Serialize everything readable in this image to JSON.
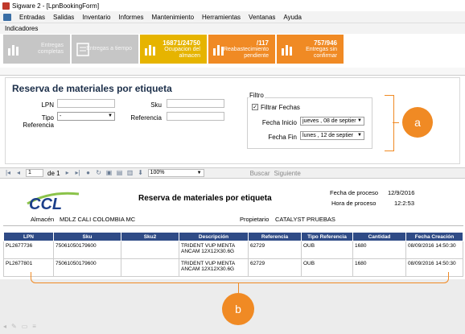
{
  "window": {
    "title": "Sigware 2 - [LpnBookingForm]"
  },
  "menu": {
    "items": [
      "Entradas",
      "Salidas",
      "Inventario",
      "Informes",
      "Mantenimiento",
      "Herramientas",
      "Ventanas",
      "Ayuda"
    ]
  },
  "indicators": {
    "label": "Indicadores",
    "tiles": [
      {
        "value": "",
        "label1": "Entregas",
        "label2": "completas",
        "color": "gray"
      },
      {
        "value": "",
        "label1": "Entregas a tiempo",
        "label2": "",
        "color": "gray"
      },
      {
        "value": "16871/24750",
        "label1": "Ocupacion del",
        "label2": "almacen",
        "color": "#e6b400"
      },
      {
        "value": "/117",
        "label1": "Reabastecimiento",
        "label2": "pendiente",
        "color": "#f08a24"
      },
      {
        "value": "757/946",
        "label1": "Entregas sin",
        "label2": "confirmar",
        "color": "#f08a24"
      }
    ]
  },
  "form": {
    "title": "Reserva de materiales por etiqueta",
    "lpn_label": "LPN",
    "tipo_label": "Tipo Referencia",
    "tipo_value": "-",
    "sku_label": "Sku",
    "referencia_label": "Referencia",
    "filtro": {
      "label": "Filtro",
      "checkbox_label": "Filtrar Fechas",
      "checked_mark": "✓",
      "fecha_inicio_label": "Fecha Inicio",
      "fecha_inicio_value": "jueves , 08 de septier",
      "fecha_fin_label": "Fecha Fin",
      "fecha_fin_value": "lunes , 12 de septier"
    }
  },
  "callouts": {
    "a": "a",
    "b": "b"
  },
  "toolbar": {
    "page": "1",
    "of_label": "de 1",
    "zoom": "100%",
    "search_label": "Buscar",
    "next_label": "Siguiente"
  },
  "report": {
    "logo_text": "CCL",
    "title": "Reserva de materiales por etiqueta",
    "fecha_proceso_label": "Fecha de proceso",
    "fecha_proceso_value": "12/9/2016",
    "hora_proceso_label": "Hora de proceso",
    "hora_proceso_value": "12:2:53",
    "almacen_label": "Almacén",
    "almacen_value": "MDLZ CALI COLOMBIA MC",
    "propietario_label": "Propietario",
    "propietario_value": "CATALYST PRUEBAS",
    "columns": [
      "LPN",
      "Sku",
      "Sku2",
      "Descripción",
      "Referencia",
      "Tipo Referencia",
      "Cantidad",
      "Fecha Creación"
    ],
    "rows": [
      [
        "PL2677736",
        "75061050179600",
        "",
        "TRIDENT VUP MENTA ANCAM 12X12X30.6G",
        "62729",
        "OUB",
        "1680",
        "08/09/2016 14:50:30"
      ],
      [
        "PL2677801",
        "75061050179600",
        "",
        "TRIDENT VUP MENTA ANCAM 12X12X30.6G",
        "62729",
        "OUB",
        "1680",
        "08/09/2016 14:50:30"
      ]
    ]
  },
  "colors": {
    "accent": "#f08a24",
    "header": "#2f4b86",
    "tile_yellow": "#e6b400"
  }
}
